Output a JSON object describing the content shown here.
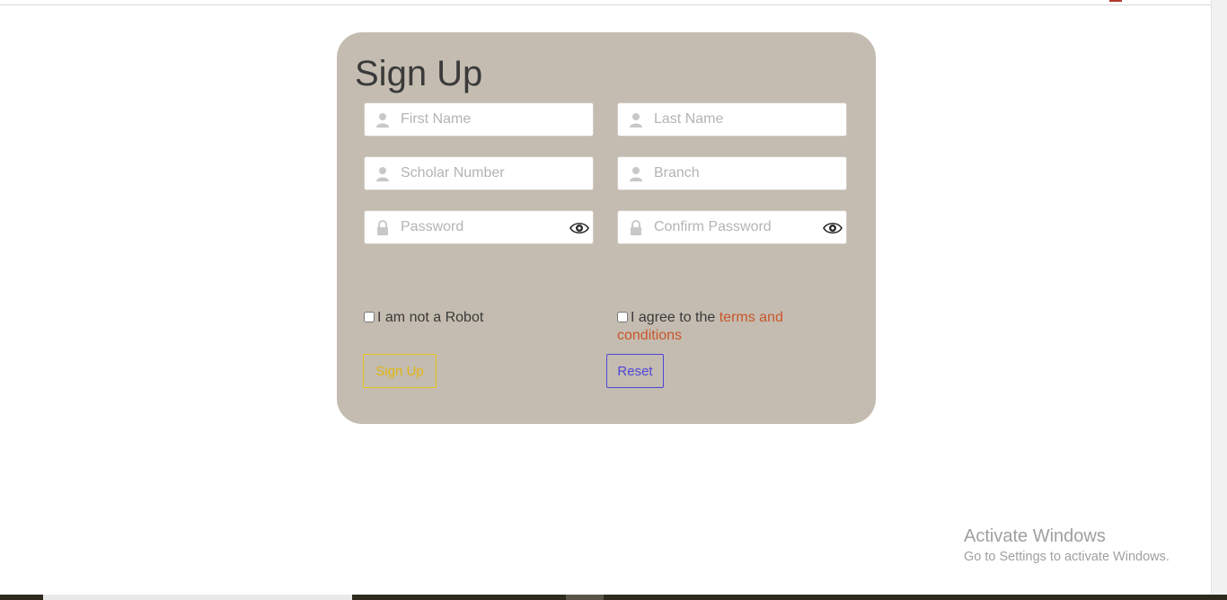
{
  "form": {
    "title": "Sign Up",
    "fields": [
      {
        "placeholder": "First Name",
        "icon": "user-icon"
      },
      {
        "placeholder": "Last Name",
        "icon": "user-icon"
      },
      {
        "placeholder": "Scholar Number",
        "icon": "user-icon"
      },
      {
        "placeholder": "Branch",
        "icon": "user-icon"
      },
      {
        "placeholder": "Password",
        "icon": "lock-icon"
      },
      {
        "placeholder": "Confirm Password",
        "icon": "lock-icon"
      }
    ],
    "robot_label": "I am not a Robot",
    "agree_label": "I agree to the ",
    "terms_link": "terms and conditions",
    "signup_button": "Sign Up",
    "reset_button": "Reset"
  },
  "watermark": {
    "title": "Activate Windows",
    "subtitle": "Go to Settings to activate Windows."
  },
  "colors": {
    "card_bg": "#c4bcb0",
    "signup_accent": "#e0b60f",
    "reset_accent": "#4f46d9",
    "link": "#c9562b"
  }
}
